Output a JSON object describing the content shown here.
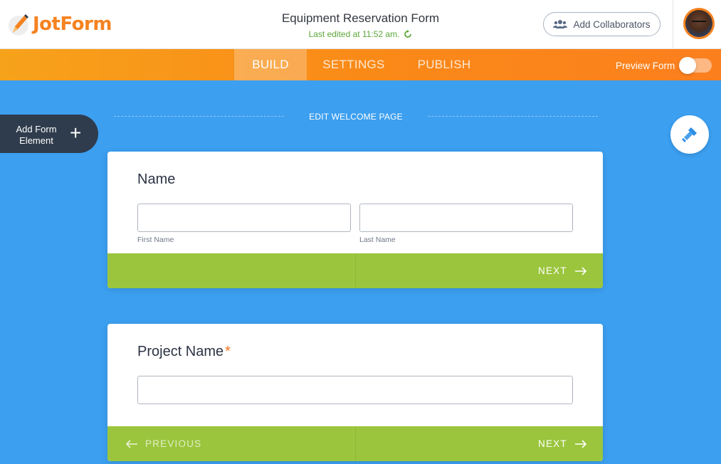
{
  "header": {
    "logo_text": "JotForm",
    "form_title": "Equipment Reservation Form",
    "last_edited": "Last edited at 11:52 am.",
    "collaborators_label": "Add Collaborators"
  },
  "nav": {
    "tabs": [
      {
        "label": "BUILD",
        "active": true
      },
      {
        "label": "SETTINGS",
        "active": false
      },
      {
        "label": "PUBLISH",
        "active": false
      }
    ],
    "preview_label": "Preview Form",
    "preview_enabled": false
  },
  "canvas": {
    "add_element_label": "Add Form Element",
    "welcome_page_label": "EDIT WELCOME PAGE"
  },
  "questions": [
    {
      "label": "Name",
      "required": false,
      "sub_labels": [
        "First Name",
        "Last Name"
      ],
      "next_label": "NEXT"
    },
    {
      "label": "Project Name",
      "required": true,
      "required_mark": "*",
      "previous_label": "PREVIOUS",
      "next_label": "NEXT"
    }
  ],
  "colors": {
    "brand_orange": "#f58220",
    "canvas_blue": "#3c9ff0",
    "footer_green": "#9bc53d",
    "dark_button": "#2f3c4d"
  }
}
